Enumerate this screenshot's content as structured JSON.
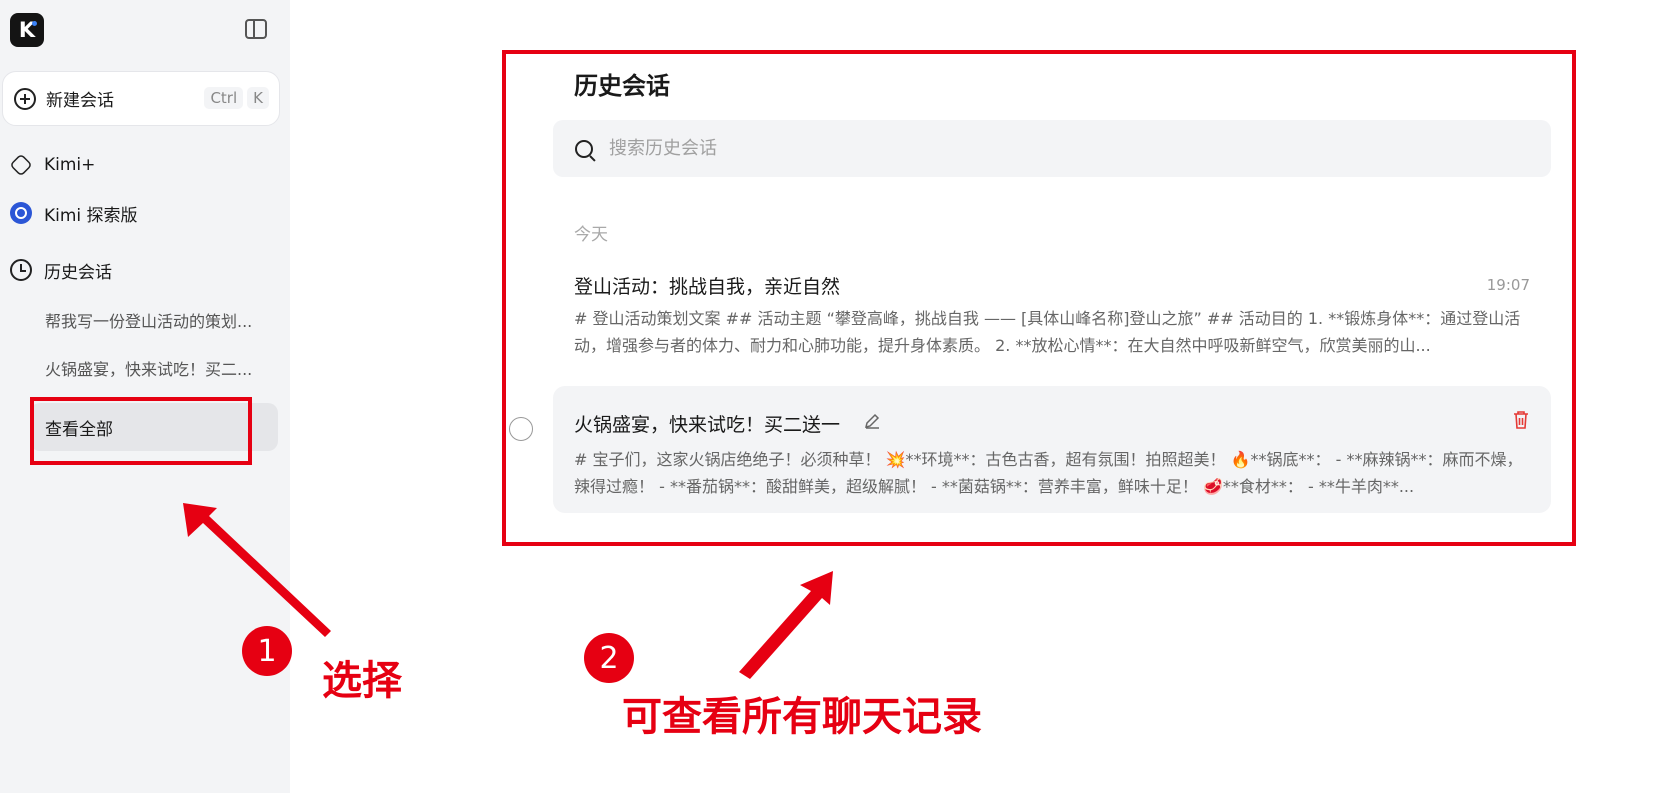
{
  "sidebar": {
    "logo_letter": "K",
    "new_chat_label": "新建会话",
    "shortcut_keys": [
      "Ctrl",
      "K"
    ],
    "nav": [
      {
        "label": "Kimi+",
        "icon": "kimi-plus-icon"
      },
      {
        "label": "Kimi 探索版",
        "icon": "explore-icon"
      },
      {
        "label": "历史会话",
        "icon": "clock-icon"
      }
    ],
    "history": [
      "帮我写一份登山活动的策划...",
      "火锅盛宴，快来试吃！买二..."
    ],
    "view_all_label": "查看全部"
  },
  "main": {
    "title": "历史会话",
    "search_placeholder": "搜索历史会话",
    "section_today": "今天",
    "conversations": [
      {
        "title": "登山活动：挑战自我，亲近自然",
        "time": "19:07",
        "preview": "# 登山活动策划文案 ## 活动主题 “攀登高峰，挑战自我 —— [具体山峰名称]登山之旅” ## 活动目的 1. **锻炼身体**：通过登山活动，增强参与者的体力、耐力和心肺功能，提升身体素质。 2. **放松心情**：在大自然中呼吸新鲜空气，欣赏美丽的山..."
      },
      {
        "title": "火锅盛宴，快来试吃！买二送一",
        "preview": "# 宝子们，这家火锅店绝绝子！必须种草！ 💥**环境**：古色古香，超有氛围！拍照超美！ 🔥**锅底**： - **麻辣锅**：麻而不燥，辣得过瘾！ - **番茄锅**：酸甜鲜美，超级解腻！ - **菌菇锅**：营养丰富，鲜味十足！ 🥩**食材**： - **牛羊肉**..."
      }
    ]
  },
  "annotations": {
    "step1_number": "1",
    "step1_text": "选择",
    "step2_number": "2",
    "step2_text": "可查看所有聊天记录"
  },
  "colors": {
    "annotation_red": "#e60012",
    "sidebar_bg": "#f3f4f6",
    "delete_red": "#e53935"
  }
}
